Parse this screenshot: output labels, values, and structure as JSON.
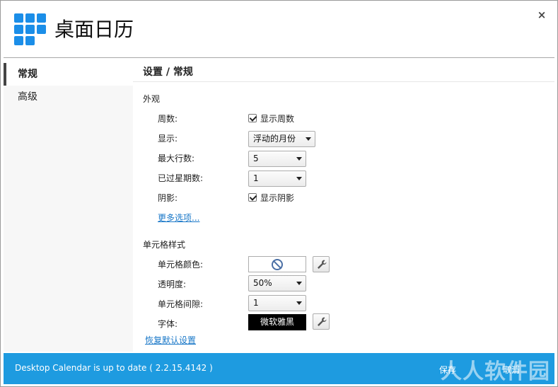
{
  "app": {
    "title": "桌面日历",
    "close_glyph": "×"
  },
  "sidebar": {
    "items": [
      {
        "label": "常规"
      },
      {
        "label": "高级"
      }
    ]
  },
  "main": {
    "page_title": "设置 / 常规",
    "appearance": {
      "section_label": "外观",
      "week_number_label": "周数:",
      "week_number_check": "显示周数",
      "display_label": "显示:",
      "display_value": "浮动的月份",
      "max_rows_label": "最大行数:",
      "max_rows_value": "5",
      "past_weeks_label": "已过星期数:",
      "past_weeks_value": "1",
      "shadow_label": "阴影:",
      "shadow_check": "显示阴影",
      "more_options_link": "更多选项..."
    },
    "cell_style": {
      "section_label": "单元格样式",
      "color_label": "单元格颜色:",
      "opacity_label": "透明度:",
      "opacity_value": "50%",
      "spacing_label": "单元格间隙:",
      "spacing_value": "1",
      "font_label": "字体:",
      "font_value": "微软雅黑"
    },
    "restore_defaults_link": "恢复默认设置"
  },
  "footer": {
    "status": "Desktop Calendar is up to date ( 2.2.15.4142 )",
    "save_label": "保存",
    "cancel_label": "取消",
    "watermark": "人人软件园"
  },
  "colors": {
    "accent": "#1e9be0",
    "logo": "#1b8ee8",
    "link": "#1a78c8"
  }
}
